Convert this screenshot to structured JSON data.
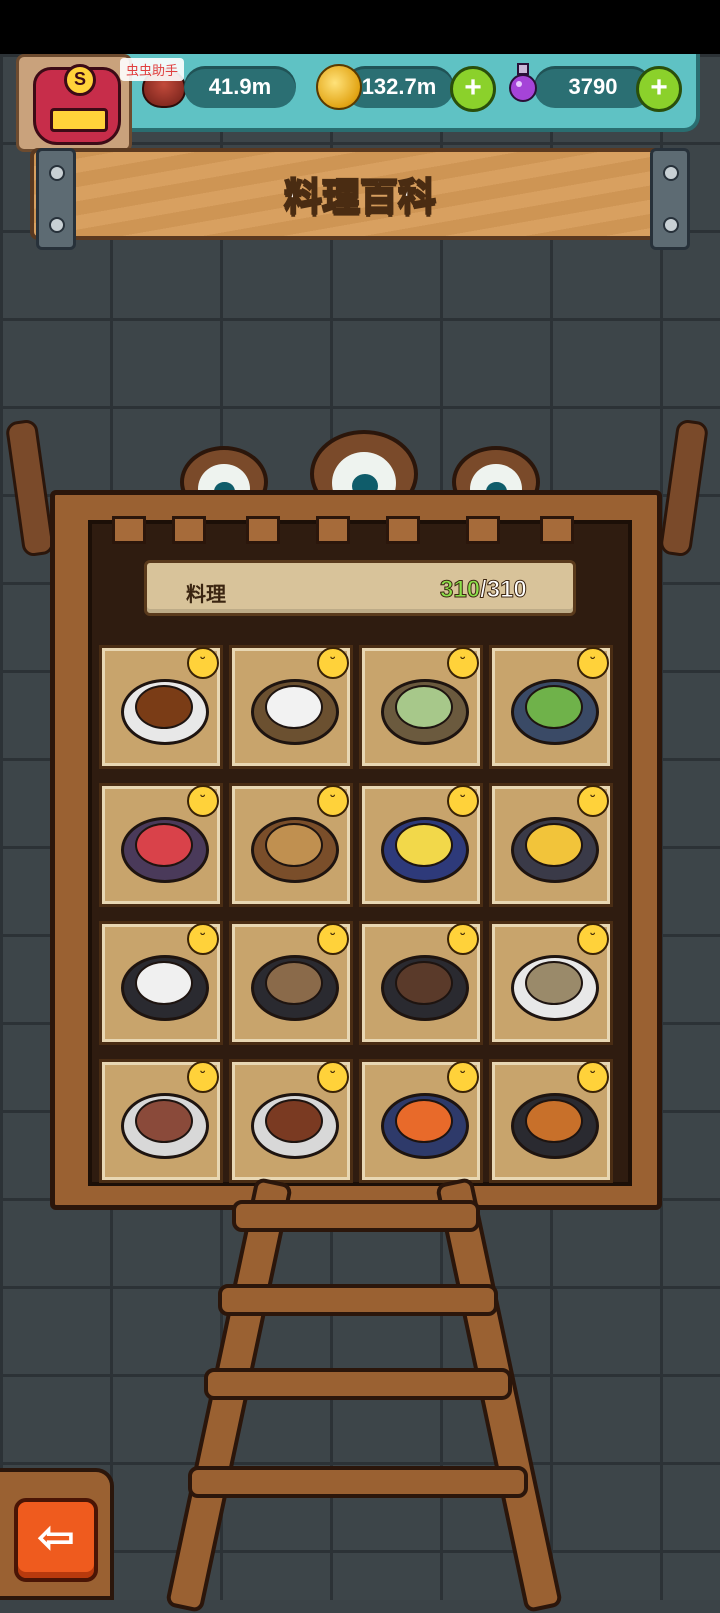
{
  "resources": {
    "meat": "41.9m",
    "coins": "132.7m",
    "potion": "3790",
    "plus_symbol": "+"
  },
  "avatar": {
    "badge": "S"
  },
  "helper_tag": "虫虫助手",
  "title": "料理百科",
  "counter": {
    "label": "料理",
    "collected": "310",
    "separator": "/",
    "total": "310"
  },
  "back_symbol": "⇦",
  "colors": {
    "accent_teal": "#5fc2c4",
    "wood": "#9a6132",
    "back_button": "#ef5b1e",
    "badge_yellow": "#ffd23a"
  },
  "dishes": [
    {
      "name": "egg-dish",
      "plate": "#e8e8e8",
      "food": "#7a3c16"
    },
    {
      "name": "rice-ball-dish",
      "plate": "#6b5030",
      "food": "#f2f2f2"
    },
    {
      "name": "fish-rice-dish",
      "plate": "#6b5a3e",
      "food": "#a7c88a"
    },
    {
      "name": "lettuce-dish",
      "plate": "#3a4a66",
      "food": "#6fb24a"
    },
    {
      "name": "crab-rice-dish",
      "plate": "#4a3a5a",
      "food": "#d9424a"
    },
    {
      "name": "mushroom-bowl-dish",
      "plate": "#7a4e2a",
      "food": "#c09050"
    },
    {
      "name": "cheese-soup-dish",
      "plate": "#2e3a7a",
      "food": "#f2d84a"
    },
    {
      "name": "tomato-egg-dish",
      "plate": "#3a3a48",
      "food": "#f2c43a"
    },
    {
      "name": "bibimbap-dish",
      "plate": "#2a2a30",
      "food": "#f0f0f0"
    },
    {
      "name": "noodle-bowl-dish",
      "plate": "#2a2a30",
      "food": "#8a6a4a"
    },
    {
      "name": "beef-noodle-dish",
      "plate": "#2a2a30",
      "food": "#5a3a2a"
    },
    {
      "name": "dumpling-noodle-dish",
      "plate": "#e8e8e8",
      "food": "#9a8a6a"
    },
    {
      "name": "sliced-meat-dish",
      "plate": "#d8d8d8",
      "food": "#8a4a3a"
    },
    {
      "name": "meatball-dish",
      "plate": "#d8d8d8",
      "food": "#7a3a22"
    },
    {
      "name": "spicy-chicken-dish",
      "plate": "#2e3a6a",
      "food": "#e86a2a"
    },
    {
      "name": "skewer-chicken-dish",
      "plate": "#2a2a30",
      "food": "#c8702a"
    }
  ]
}
